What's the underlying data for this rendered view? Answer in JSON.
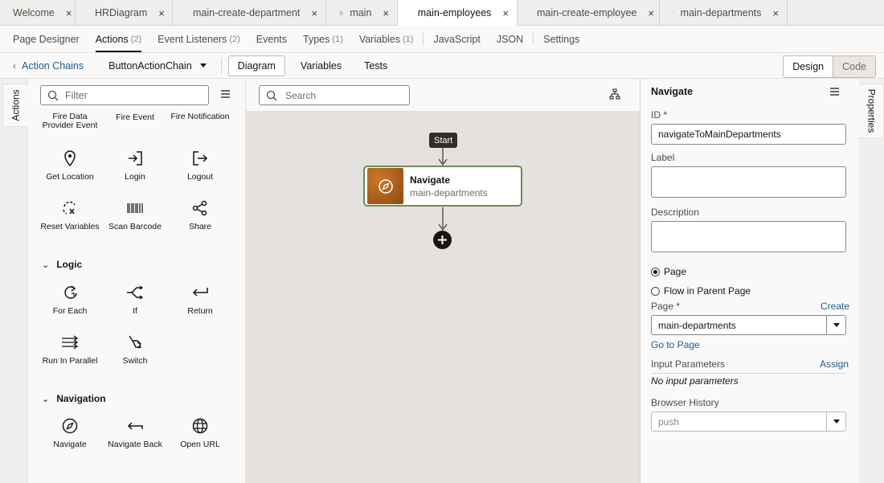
{
  "editor_tabs": [
    {
      "label": "Welcome",
      "icon": "none",
      "active": false
    },
    {
      "label": "HRDiagram",
      "icon": "diagram-icon",
      "active": false
    },
    {
      "label": "main-create-department",
      "icon": "page-icon",
      "active": false
    },
    {
      "label": "main",
      "icon": "page-icon",
      "active": false
    },
    {
      "label": "main-employees",
      "icon": "page-icon",
      "active": true
    },
    {
      "label": "main-create-employee",
      "icon": "page-icon",
      "active": false
    },
    {
      "label": "main-departments",
      "icon": "page-icon",
      "active": false
    }
  ],
  "tab_close_glyph": "×",
  "designer_tabs": [
    {
      "label": "Page Designer",
      "count": ""
    },
    {
      "label": "Actions",
      "count": "(2)"
    },
    {
      "label": "Event Listeners",
      "count": "(2)"
    },
    {
      "label": "Events",
      "count": ""
    },
    {
      "label": "Types",
      "count": "(1)"
    },
    {
      "label": "Variables",
      "count": "(1)"
    },
    {
      "label": "JavaScript",
      "count": ""
    },
    {
      "label": "JSON",
      "count": ""
    },
    {
      "label": "Settings",
      "count": ""
    }
  ],
  "toolbar": {
    "back_label": "Action Chains",
    "chain_name": "ButtonActionChain",
    "view_tabs": [
      "Diagram",
      "Variables",
      "Tests"
    ],
    "design_label": "Design",
    "code_label": "Code"
  },
  "left_rail": {
    "tab_label": "Actions"
  },
  "palette": {
    "filter_placeholder": "Filter",
    "partial_row": [
      "Fire Data Provider Event",
      "Fire Event",
      "Fire Notification"
    ],
    "row1": [
      {
        "label": "Get Location",
        "icon": "location-pin-icon"
      },
      {
        "label": "Login",
        "icon": "login-icon"
      },
      {
        "label": "Logout",
        "icon": "logout-icon"
      }
    ],
    "row2": [
      {
        "label": "Reset Variables",
        "icon": "reset-variables-icon"
      },
      {
        "label": "Scan Barcode",
        "icon": "barcode-icon"
      },
      {
        "label": "Share",
        "icon": "share-icon"
      }
    ],
    "logic_heading": "Logic",
    "logic_row1": [
      {
        "label": "For Each",
        "icon": "for-each-icon"
      },
      {
        "label": "If",
        "icon": "if-branch-icon"
      },
      {
        "label": "Return",
        "icon": "return-icon"
      }
    ],
    "logic_row2": [
      {
        "label": "Run In Parallel",
        "icon": "parallel-icon"
      },
      {
        "label": "Switch",
        "icon": "switch-icon"
      }
    ],
    "navigation_heading": "Navigation",
    "navigation_row": [
      {
        "label": "Navigate",
        "icon": "compass-icon"
      },
      {
        "label": "Navigate Back",
        "icon": "navigate-back-icon"
      },
      {
        "label": "Open URL",
        "icon": "globe-icon"
      }
    ]
  },
  "canvas": {
    "search_placeholder": "Search",
    "start_label": "Start",
    "node_title": "Navigate",
    "node_subtitle": "main-departments",
    "node_color": "#a35d1e"
  },
  "properties": {
    "title": "Navigate",
    "id_label": "ID *",
    "id_value": "navigateToMainDepartments",
    "label_label": "Label",
    "description_label": "Description",
    "radio_page": "Page",
    "radio_flow": "Flow in Parent Page",
    "page_label": "Page *",
    "create_link": "Create",
    "page_value": "main-departments",
    "go_to_page": "Go to Page",
    "input_params_label": "Input Parameters",
    "assign_link": "Assign",
    "no_input_params": "No input parameters",
    "browser_history_label": "Browser History",
    "browser_history_value": "push"
  },
  "right_rail": {
    "tab_label": "Properties"
  },
  "colors": {
    "accent": "#1e5c8a",
    "node_border": "#6e8a56",
    "dark": "#161513"
  }
}
